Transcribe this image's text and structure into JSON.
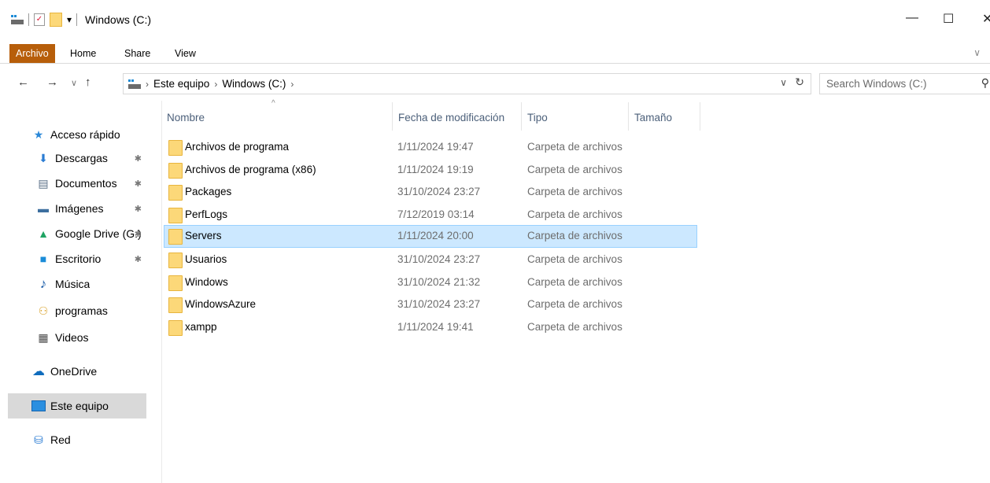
{
  "window": {
    "title": "Windows (C:)",
    "qa_dropdown": "▾",
    "minimize": "—",
    "maximize": "☐",
    "close": "✕"
  },
  "ribbon": {
    "tabs": [
      "Archivo",
      "Home",
      "Share",
      "View"
    ],
    "expand": "∨",
    "file_color": "#b75e0a"
  },
  "address": {
    "back": "←",
    "forward": "→",
    "recent": "∨",
    "up": "↑",
    "sep": "›",
    "crumbs": [
      "Este equipo",
      "Windows (C:)"
    ],
    "dropdown": "∨",
    "refresh": "↻"
  },
  "search": {
    "placeholder": "Search Windows (C:)",
    "icon": "⚲"
  },
  "sidebar": {
    "pin": "✱",
    "items": [
      {
        "label": "Acceso rápido",
        "icon": "star-icon",
        "glyph": "★"
      },
      {
        "label": "Descargas",
        "icon": "download-icon",
        "glyph": "⬇"
      },
      {
        "label": "Documentos",
        "icon": "document-icon",
        "glyph": "▤"
      },
      {
        "label": "Imágenes",
        "icon": "image-icon",
        "glyph": "▬"
      },
      {
        "label": "Google Drive (G:)",
        "icon": "google-drive-icon",
        "glyph": "▲"
      },
      {
        "label": "Escritorio",
        "icon": "desktop-icon",
        "glyph": "■"
      },
      {
        "label": "Música",
        "icon": "music-icon",
        "glyph": "♪"
      },
      {
        "label": "programas",
        "icon": "user-folder-icon",
        "glyph": "⚇"
      },
      {
        "label": "Videos",
        "icon": "video-icon",
        "glyph": "▦"
      },
      {
        "label": "OneDrive",
        "icon": "cloud-icon",
        "glyph": "☁"
      },
      {
        "label": "Este equipo",
        "icon": "computer-icon",
        "glyph": "▭"
      },
      {
        "label": "Red",
        "icon": "network-icon",
        "glyph": "⛁"
      }
    ]
  },
  "columns": {
    "name": "Nombre",
    "date": "Fecha de modificación",
    "type": "Tipo",
    "size": "Tamaño",
    "sort": "^"
  },
  "files": [
    {
      "name": "Archivos de programa",
      "date": "1/11/2024 19:47",
      "type": "Carpeta de archivos"
    },
    {
      "name": "Archivos de programa (x86)",
      "date": "1/11/2024 19:19",
      "type": "Carpeta de archivos"
    },
    {
      "name": "Packages",
      "date": "31/10/2024 23:27",
      "type": "Carpeta de archivos"
    },
    {
      "name": "PerfLogs",
      "date": "7/12/2019 03:14",
      "type": "Carpeta de archivos"
    },
    {
      "name": "Servers",
      "date": "1/11/2024 20:00",
      "type": "Carpeta de archivos"
    },
    {
      "name": "Usuarios",
      "date": "31/10/2024 23:27",
      "type": "Carpeta de archivos"
    },
    {
      "name": "Windows",
      "date": "31/10/2024 21:32",
      "type": "Carpeta de archivos"
    },
    {
      "name": "WindowsAzure",
      "date": "31/10/2024 23:27",
      "type": "Carpeta de archivos"
    },
    {
      "name": "xampp",
      "date": "1/11/2024 19:41",
      "type": "Carpeta de archivos"
    }
  ],
  "selected_file": "Servers"
}
